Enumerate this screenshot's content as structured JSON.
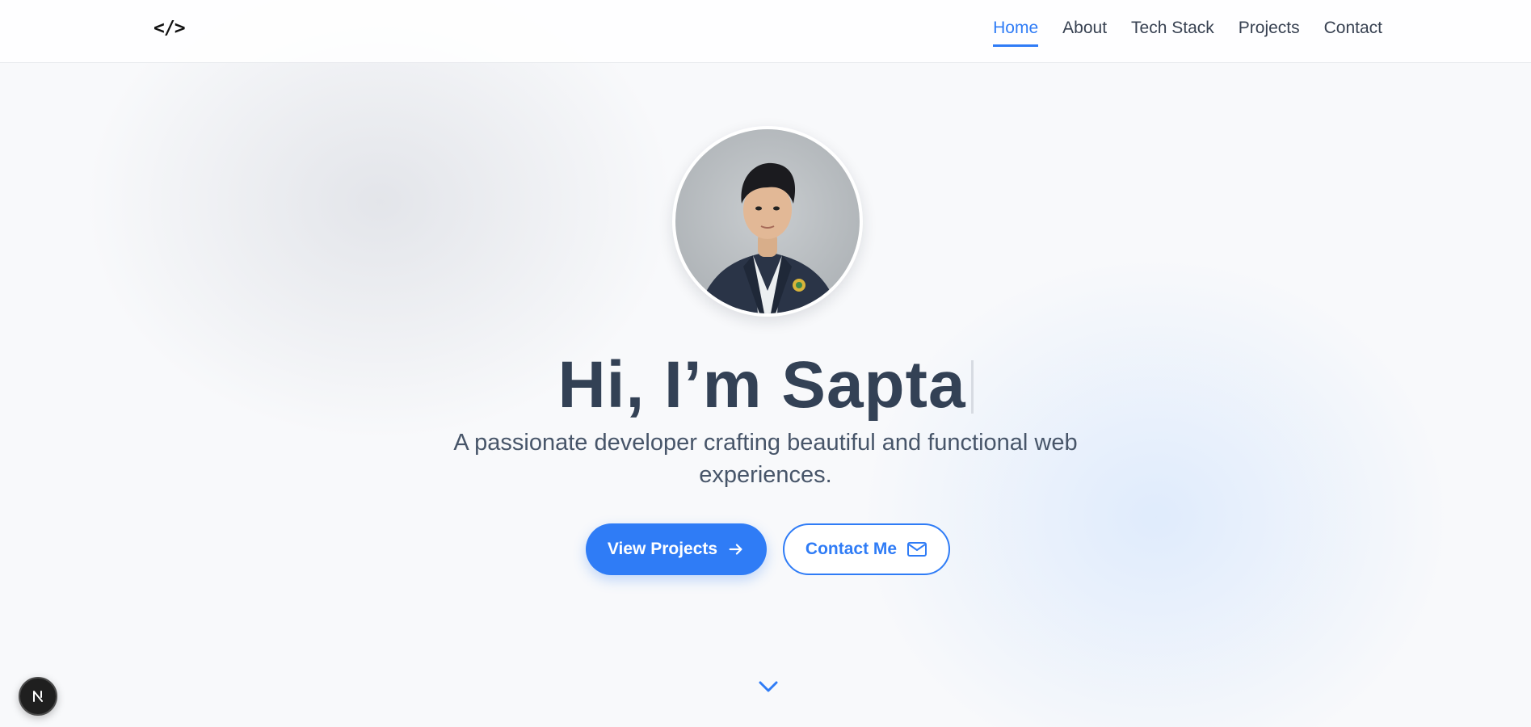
{
  "header": {
    "logo": "</>",
    "nav": [
      {
        "label": "Home",
        "active": true
      },
      {
        "label": "About",
        "active": false
      },
      {
        "label": "Tech Stack",
        "active": false
      },
      {
        "label": "Projects",
        "active": false
      },
      {
        "label": "Contact",
        "active": false
      }
    ]
  },
  "hero": {
    "avatar_icon": "profile-photo",
    "title": "Hi, I’m Sapta",
    "subtitle": "A passionate developer crafting beautiful and functional web experiences.",
    "primary_button": {
      "label": "View Projects",
      "icon": "arrow-right-icon"
    },
    "secondary_button": {
      "label": "Contact Me",
      "icon": "mail-icon"
    },
    "scroll_icon": "chevron-down-icon"
  },
  "dev_indicator": {
    "label": "N"
  },
  "colors": {
    "accent": "#2f7cf6",
    "heading": "#334155",
    "text": "#475569"
  }
}
